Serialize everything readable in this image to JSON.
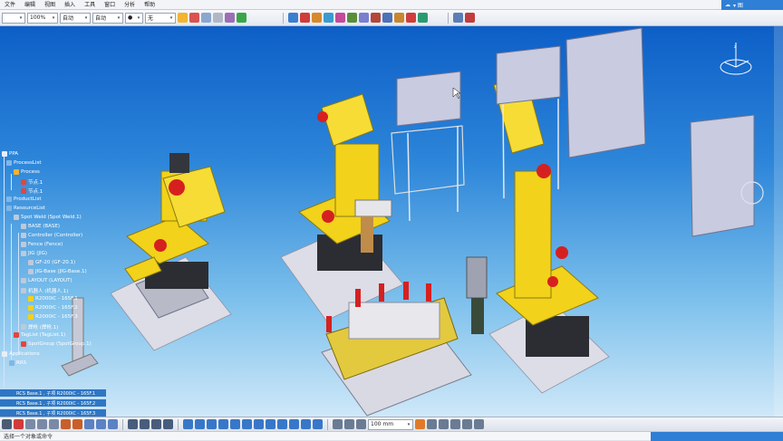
{
  "menu": {
    "items": [
      "文件",
      "编辑",
      "视图",
      "插入",
      "工具",
      "窗口",
      "分析",
      "帮助"
    ],
    "top_right_label": "▾ 图"
  },
  "toolbar": {
    "layer_value": "",
    "zoom_value": "100%",
    "mode_value": "自动",
    "style_value": "自动",
    "line_value": "●",
    "color_value": "无"
  },
  "tree": {
    "root": "PPA",
    "nodes": [
      "ProcessList",
      "Process",
      "节点.1",
      "节点.1",
      "ProductList",
      "ResourceList",
      "Spot Weld (Spot Weld.1)",
      "BASE (BASE)",
      "Controller (Controller)",
      "Fence (Fence)",
      "JIG (JIG)",
      "GF-20 (GF-20.1)",
      "JIG-Base (JIG-Base.1)",
      "LAYOUT (LAYOUT)",
      "机器人 (机器人.1)",
      "R2000iC - 165F.1",
      "R2000iC - 165F.2",
      "R2000iC - 165F.3",
      "焊枪 (焊枪.1)",
      "TagList (TagList.1)",
      "SpotGroup (SpotGroup.1)"
    ],
    "applications_label": "Applications",
    "apps_root": "RRS"
  },
  "apps_rows": [
    "RCS  Base.1 , 子项  R2000iC - 165F.1",
    "RCS  Base.1 , 子项  R2000iC - 165F.2",
    "RCS  Base.1 , 子项  R2000iC - 165F.3"
  ],
  "bottom_toolbar": {
    "unit_value": "100 mm"
  },
  "status": {
    "message": "选择一个对象或命令"
  },
  "colors": {
    "robot_yellow": "#f2d21a",
    "robot_red": "#d62020",
    "viewport_top": "#0d5fc7",
    "viewport_bottom": "#cfe8f8",
    "cabinet": "#c9cbe0",
    "accent_blue": "#2f7fd6"
  }
}
